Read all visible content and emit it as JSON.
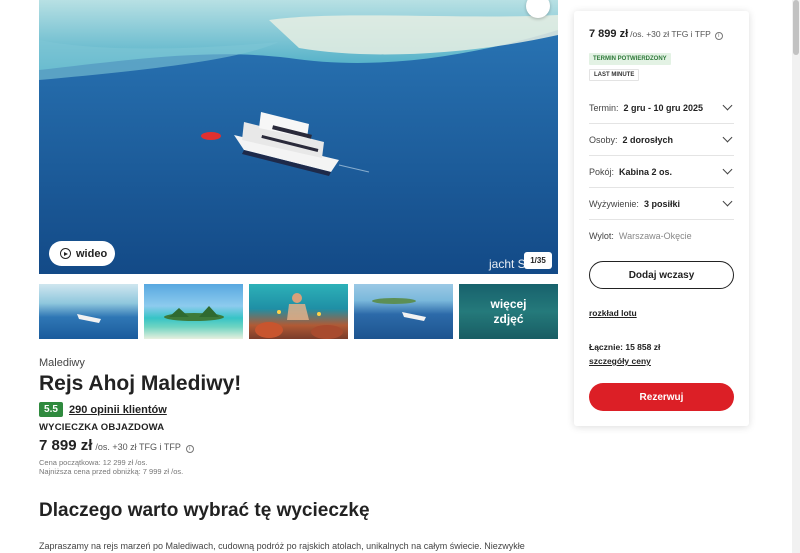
{
  "hero": {
    "watermark": "jacht S",
    "counter": "1/35",
    "video_label": "wideo"
  },
  "thumbnails": {
    "more_label": "więcej zdjęć"
  },
  "product": {
    "country": "Malediwy",
    "title": "Rejs Ahoj Malediwy!",
    "score": "5.5",
    "reviews": "290 opinii klientów",
    "trip_type": "WYCIECZKA OBJAZDOWA",
    "price": "7 899 zł",
    "price_suffix": "/os. +30 zł TFG i TFP",
    "initial_price": "Cena początkowa: 12 299 zł /os.",
    "lowest_price": "Najniższa cena przed obniżką: 7 999 zł /os.",
    "section_title": "Dlaczego warto wybrać tę wycieczkę",
    "description": "Zapraszamy na rejs marzeń po Malediwach, cudowną podróż po rajskich atolach, unikalnych na całym świecie. Niezwykłe"
  },
  "booking": {
    "price": "7 899 zł",
    "price_suffix": "/os. +30 zł TFG i TFP",
    "badge_confirmed": "TERMIN POTWIERDZONY",
    "badge_last_minute": "LAST MINUTE",
    "fields": [
      {
        "label": "Termin:",
        "value": "2 gru - 10 gru 2025"
      },
      {
        "label": "Osoby:",
        "value": "2 dorosłych"
      },
      {
        "label": "Pokój:",
        "value": "Kabina 2 os."
      },
      {
        "label": "Wyżywienie:",
        "value": "3 posiłki"
      },
      {
        "label": "Wylot:",
        "value": "Warszawa-Okęcie"
      }
    ],
    "add_button": "Dodaj wczasy",
    "schedule_link": "rozkład lotu",
    "total": "Łącznie: 15 858 zł",
    "price_details_link": "szczegóły ceny",
    "reserve_button": "Rezerwuj"
  },
  "colors": {
    "accent_red": "#dc1f26",
    "score_green": "#2f8a3e",
    "badge_green_bg": "#e3f2e4"
  },
  "icons": [
    "heart-icon",
    "play-icon",
    "info-icon",
    "chevron-down-icon"
  ]
}
